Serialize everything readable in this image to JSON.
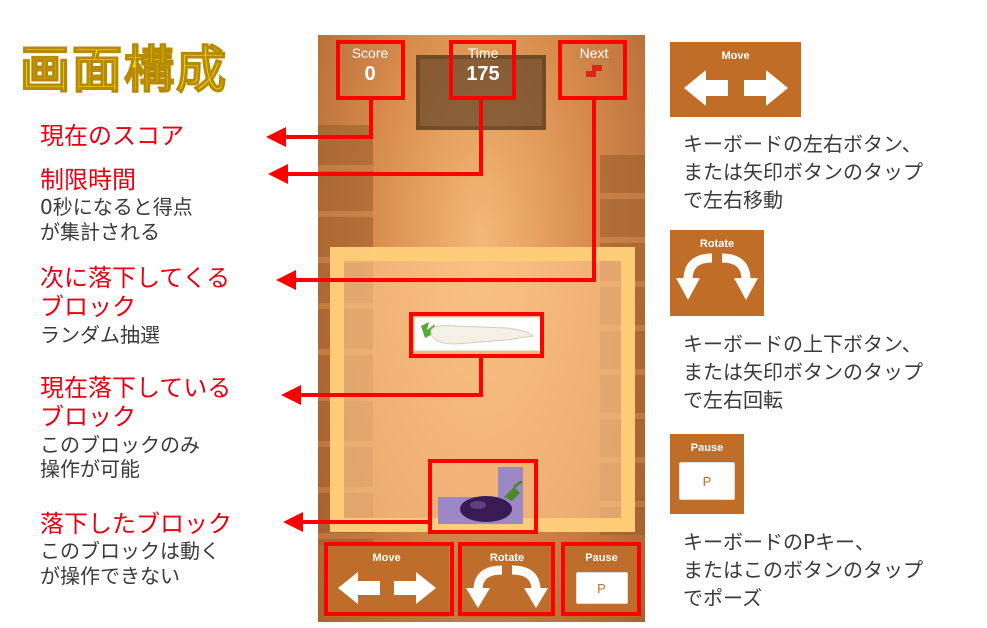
{
  "title": "画面構成",
  "annotations": {
    "score": {
      "heading": "現在のスコア"
    },
    "time": {
      "heading": "制限時間",
      "desc": [
        "0秒になると得点",
        "が集計される"
      ]
    },
    "next": {
      "heading": [
        "次に落下してくる",
        "ブロック"
      ],
      "desc": [
        "ランダム抽選"
      ]
    },
    "current": {
      "heading": [
        "現在落下している",
        "ブロック"
      ],
      "desc": [
        "このブロックのみ",
        "操作が可能"
      ]
    },
    "landed": {
      "heading": "落下したブロック",
      "desc": [
        "このブロックは動く",
        "が操作できない"
      ]
    }
  },
  "game": {
    "hud": {
      "score_label": "Score",
      "score_value": "0",
      "time_label": "Time",
      "time_value": "175",
      "next_label": "Next"
    },
    "controls": {
      "move_label": "Move",
      "rotate_label": "Rotate",
      "pause_label": "Pause",
      "pause_key": "P"
    }
  },
  "legend": {
    "move": {
      "label": "Move",
      "desc": [
        "キーボードの左右ボタン、",
        "または矢印ボタンのタップ",
        "で左右移動"
      ]
    },
    "rotate": {
      "label": "Rotate",
      "desc": [
        "キーボードの上下ボタン、",
        "または矢印ボタンのタップ",
        "で左右回転"
      ]
    },
    "pause": {
      "label": "Pause",
      "key": "P",
      "desc": [
        "キーボードのPキー、",
        "またはこのボタンのタップ",
        "でポーズ"
      ]
    }
  },
  "colors": {
    "annotation_red": "#e60012",
    "highlight_red": "#ff0000",
    "panel_brown": "#c06d28",
    "title_yellow": "#ffe400"
  },
  "icons": [
    "left-arrow-icon",
    "right-arrow-icon",
    "rotate-left-icon",
    "rotate-right-icon",
    "daikon-block-icon",
    "eggplant-block-icon",
    "next-block-icon"
  ]
}
